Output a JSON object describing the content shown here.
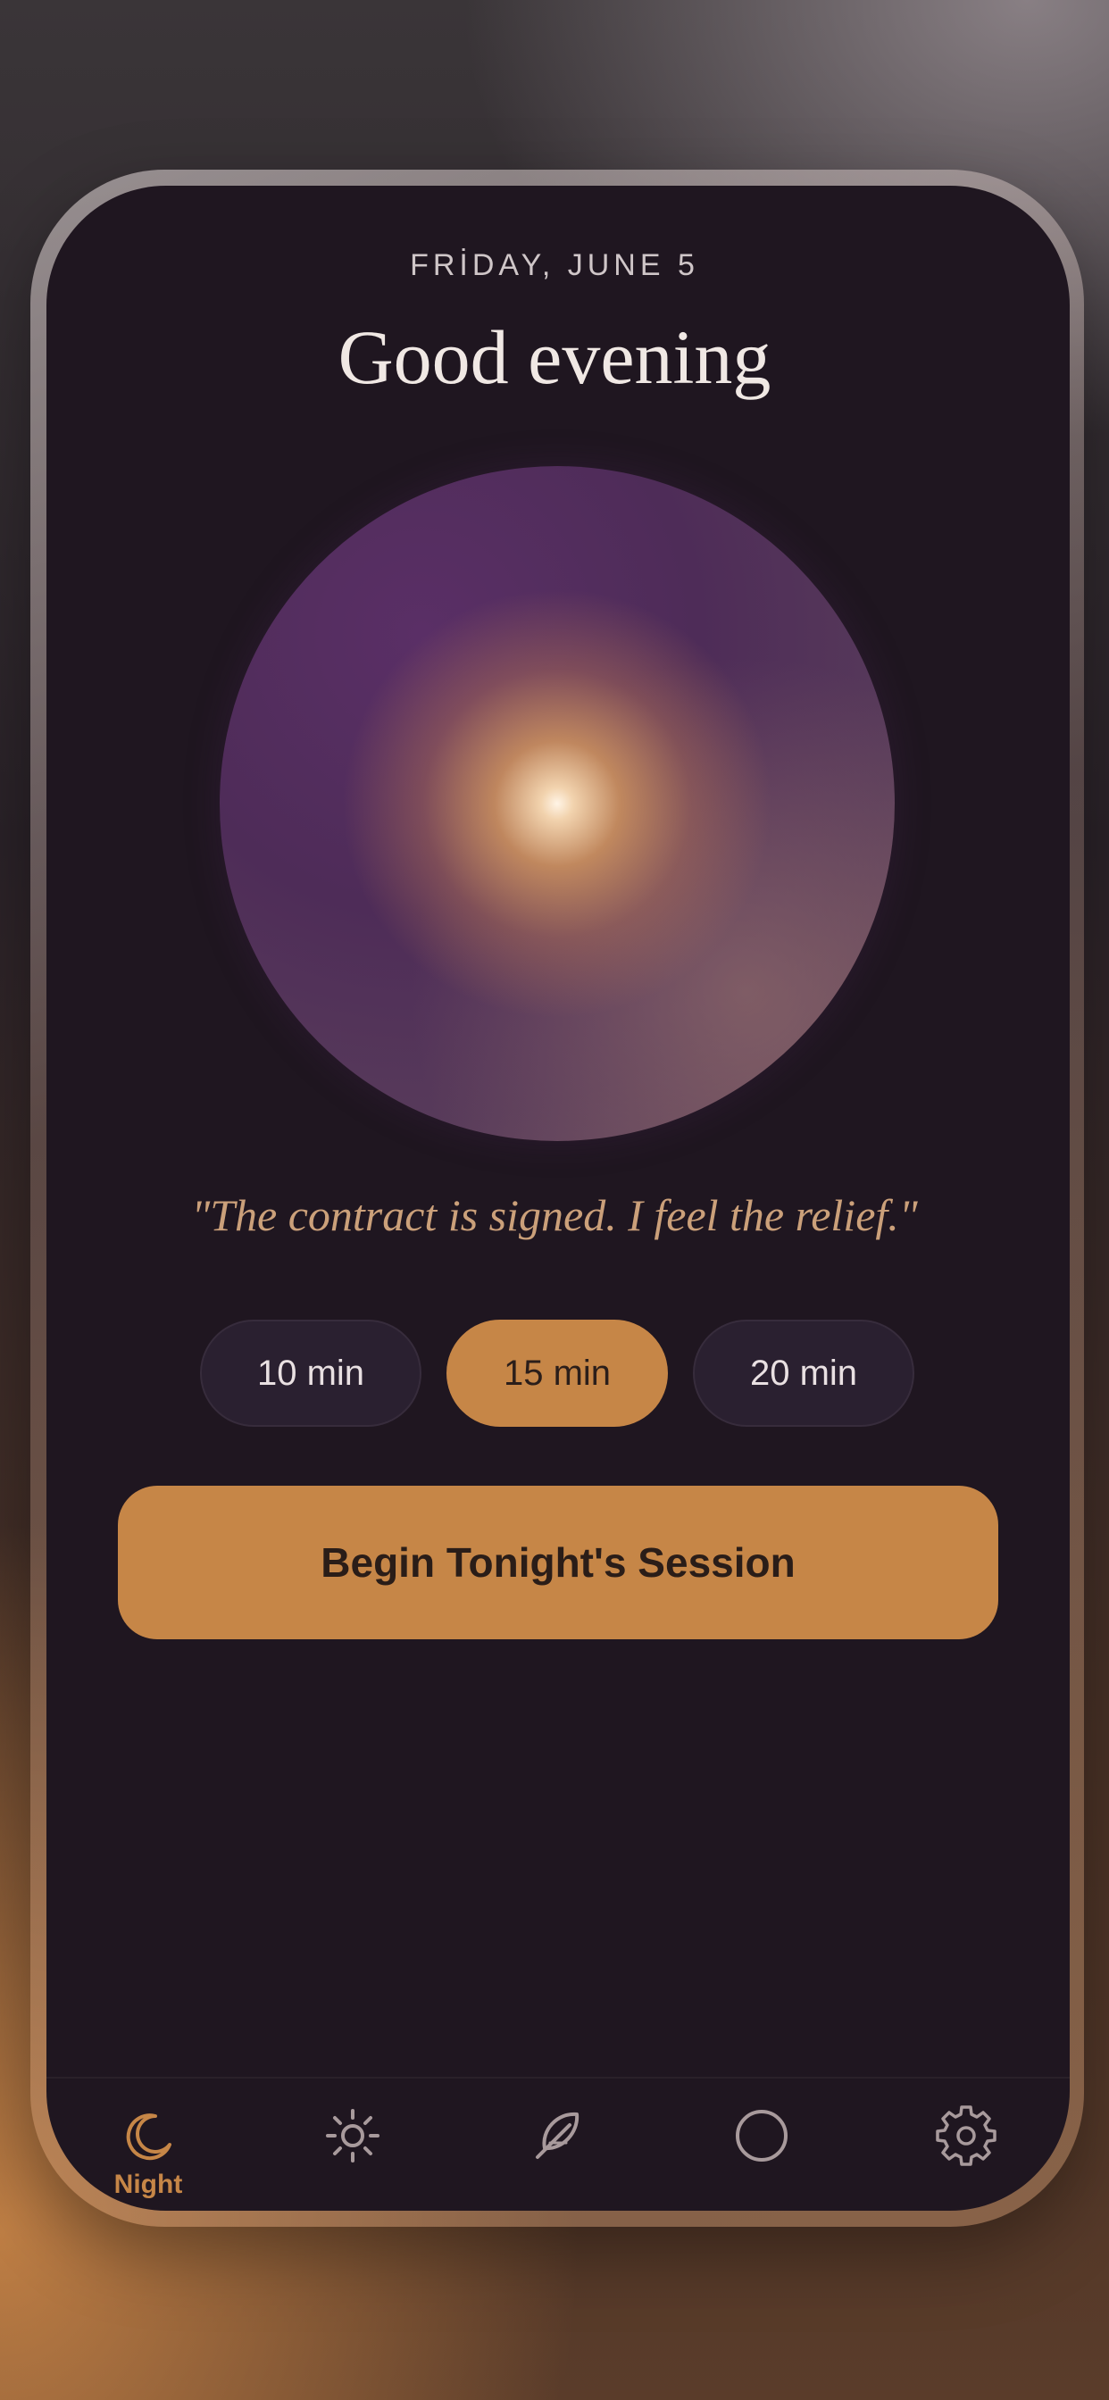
{
  "header": {
    "date": "FRİDAY, JUNE 5",
    "greeting": "Good evening"
  },
  "orb": {
    "icon": "glowing-orb"
  },
  "quote": "\"The contract is signed. I feel the relief.\"",
  "durations": {
    "options": [
      "10 min",
      "15 min",
      "20 min"
    ],
    "selected": "15 min"
  },
  "begin_button": {
    "label": "Begin Tonight's Session"
  },
  "tabbar": {
    "items": [
      {
        "icon": "moon-icon",
        "label": "Night",
        "active": true
      },
      {
        "icon": "sun-icon",
        "label": "",
        "active": false
      },
      {
        "icon": "feather-icon",
        "label": "",
        "active": false
      },
      {
        "icon": "circle-icon",
        "label": "",
        "active": false
      },
      {
        "icon": "gear-icon",
        "label": "",
        "active": false
      }
    ]
  },
  "colors": {
    "accent": "#c68647",
    "screen_background": "#1f1620",
    "inactive_icon": "#a89a9c"
  }
}
